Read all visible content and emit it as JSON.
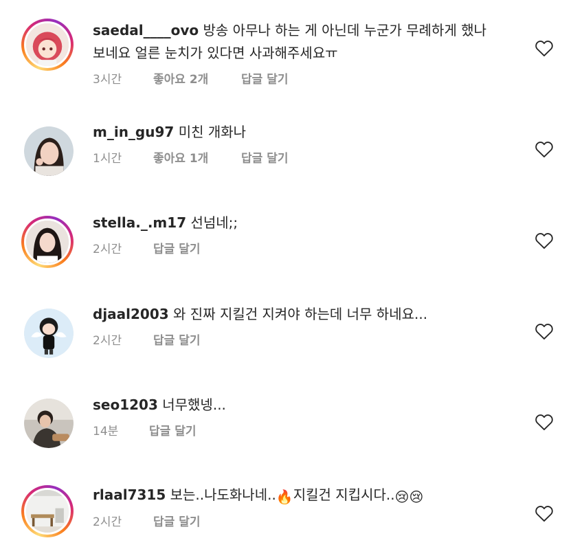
{
  "comments": [
    {
      "username": "saedal____ovo",
      "text": "방송 아무나 하는 게 아닌데 누군가 무례하게 했나보네요 얼른 눈치가 있다면 사과해주세요ㅠ",
      "time": "3시간",
      "likes": "좋아요 2개",
      "reply": "답글 달기",
      "avatar": "anime-girl-avatar",
      "story_ring": true
    },
    {
      "username": "m_in_gu97",
      "text": "미친 개화나",
      "time": "1시간",
      "likes": "좋아요 1개",
      "reply": "답글 달기",
      "avatar": "woman-photo-avatar",
      "story_ring": false
    },
    {
      "username": "stella._.m17",
      "text": "선넘네;;",
      "time": "2시간",
      "reply": "답글 달기",
      "avatar": "woman-selfie-avatar",
      "story_ring": true
    },
    {
      "username": "djaal2003",
      "text": "와 진짜 지킬건 지켜야 하는데 너무 하네요...",
      "time": "2시간",
      "reply": "답글 달기",
      "avatar": "angel-character-avatar",
      "story_ring": false
    },
    {
      "username": "seo1203",
      "text": "너무했넹...",
      "time": "14분",
      "reply": "답글 달기",
      "avatar": "man-photo-avatar",
      "story_ring": false
    },
    {
      "username": "rlaal7315",
      "text_before": "보는..나도화나네..",
      "text_after": "지킬건 지킵시다..",
      "emoji_fire": "🔥",
      "emoji_sad": "😢😢",
      "time": "2시간",
      "reply": "답글 달기",
      "avatar": "room-photo-avatar",
      "story_ring": true
    }
  ],
  "colors": {
    "text": "#262626",
    "meta": "#8e8e8e",
    "ring_gradient": [
      "#feda75",
      "#fa7e1e",
      "#d62976",
      "#962fbf"
    ]
  },
  "icons": {
    "like": "heart-outline-icon"
  }
}
